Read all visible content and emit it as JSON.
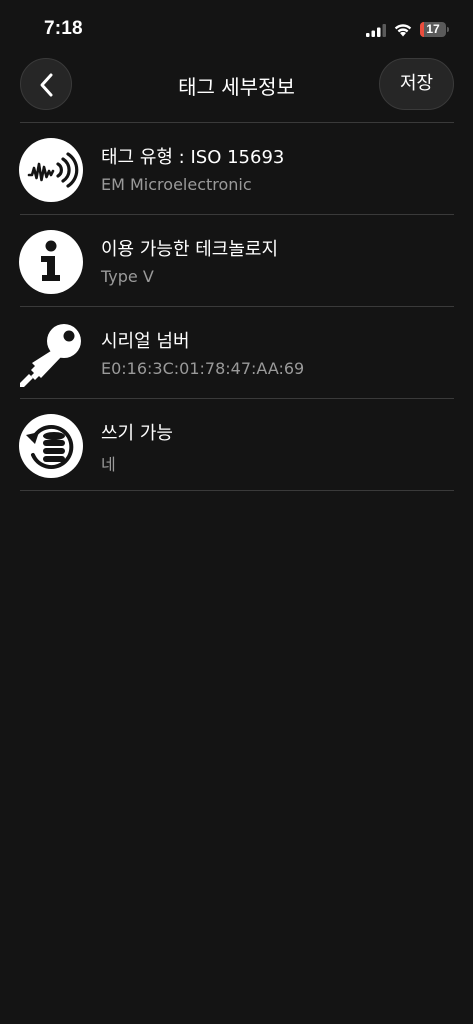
{
  "status_bar": {
    "time": "7:18",
    "battery_level": "17",
    "battery_fraction": 0.17
  },
  "header": {
    "title": "태그 세부정보",
    "save_label": "저장"
  },
  "rows": [
    {
      "icon": "nfc-waveform-icon",
      "label": "태그 유형 : ISO 15693",
      "value": "EM Microelectronic"
    },
    {
      "icon": "info-icon",
      "label": "이용 가능한 테크놀로지",
      "value": "Type V"
    },
    {
      "icon": "key-icon",
      "label": "시리얼 넘버",
      "value": "E0:16:3C:01:78:47:AA:69"
    },
    {
      "icon": "database-sync-icon",
      "label": "쓰기 가능",
      "value": "네"
    }
  ],
  "colors": {
    "background": "#141414",
    "divider": "#3a3a3a",
    "secondary_text": "#9a9a9a",
    "battery_low": "#eb4d3d"
  }
}
